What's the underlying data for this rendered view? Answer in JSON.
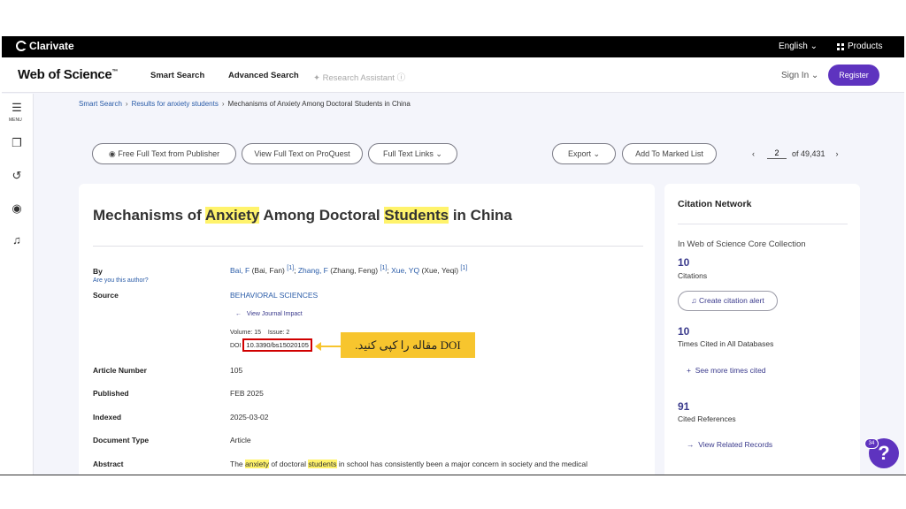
{
  "topbar": {
    "logo": "Clarivate",
    "language": "English ⌄",
    "products": "Products"
  },
  "header": {
    "brand": "Web of Science",
    "brand_tm": "™",
    "nav": [
      "Smart Search",
      "Advanced Search",
      "Research Assistant"
    ],
    "sign_in": "Sign In ⌄",
    "register": "Register"
  },
  "rail": {
    "menu_label": "MENU",
    "icons": [
      "menu-icon",
      "bookmarks-icon",
      "history-icon",
      "account-icon",
      "bell-icon"
    ]
  },
  "breadcrumb": {
    "items": [
      "Smart Search",
      "Results for anxiety students",
      "Mechanisms of Anxiety Among Doctoral Students in China"
    ],
    "sep": "›"
  },
  "actions": {
    "free_full_text": "Free Full Text from Publisher",
    "proquest": "View Full Text on ProQuest",
    "full_text_links": "Full Text Links",
    "export": "Export",
    "add_marked": "Add To Marked List",
    "page_value": "2",
    "page_of": "of 49,431"
  },
  "record": {
    "title_parts": [
      "Mechanisms of ",
      "Anxiety",
      " Among Doctoral ",
      "Students",
      " in China"
    ],
    "by_label": "By",
    "are_you_author": "Are you this author?",
    "authors": [
      {
        "short": "Bai, F",
        "full": " (Bai, Fan) ",
        "ref": "[1]"
      },
      {
        "short": "Zhang, F",
        "full": " (Zhang, Feng) ",
        "ref": "[1]"
      },
      {
        "short": "Xue, YQ",
        "full": " (Xue, Yeqi) ",
        "ref": "[1]"
      }
    ],
    "author_sep": "; ",
    "source_label": "Source",
    "source": "BEHAVIORAL SCIENCES",
    "view_journal_impact": "View Journal Impact",
    "volume": "Volume: 15",
    "issue": "Issue: 2",
    "doi_label": "DOI",
    "doi": "10.3390/bs15020105",
    "article_number_label": "Article Number",
    "article_number": "105",
    "published_label": "Published",
    "published": "FEB 2025",
    "indexed_label": "Indexed",
    "indexed": "2025-03-02",
    "doc_type_label": "Document Type",
    "doc_type": "Article",
    "abstract_label": "Abstract",
    "abstract_parts": [
      "The ",
      "anxiety",
      " of doctoral ",
      "students",
      " in school has consistently been a major concern in society and the medical"
    ]
  },
  "annotation": {
    "text": "DOI مقاله را کپی کنید.",
    "color": "#f7c52e"
  },
  "citation_network": {
    "title": "Citation Network",
    "subtitle": "In Web of Science Core Collection",
    "citations": "10",
    "citations_label": "Citations",
    "create_alert": "Create citation alert",
    "times_cited": "10",
    "times_cited_label": "Times Cited in All Databases",
    "see_more": "See more times cited",
    "cited_refs": "91",
    "cited_refs_label": "Cited References",
    "view_related": "View Related Records"
  },
  "help": {
    "badge": "34",
    "symbol": "?"
  },
  "colors": {
    "accent": "#5e33bf",
    "link": "#2a5ca8",
    "highlight": "#fff36b",
    "doi_box": "#d00000"
  }
}
